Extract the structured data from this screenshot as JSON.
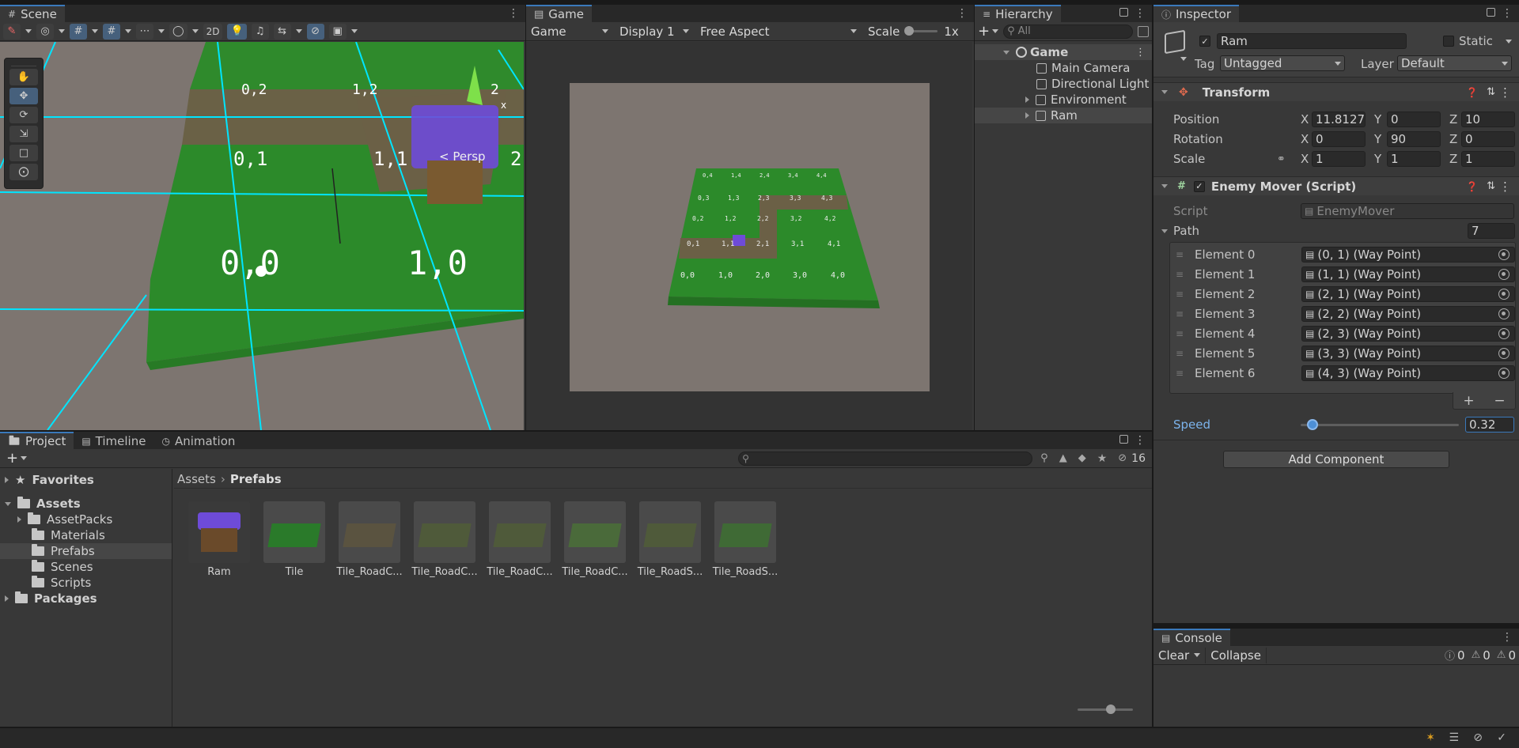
{
  "scene": {
    "tab": "Scene",
    "btn_2d": "2D",
    "labels": [
      "0,2",
      "1,2",
      "2",
      "0,1",
      "1,1",
      "2",
      "0,0",
      "1,0"
    ],
    "persp": "< Persp",
    "axis_x": "x"
  },
  "game": {
    "tab": "Game",
    "mode": "Game",
    "display": "Display 1",
    "aspect": "Free Aspect",
    "scale_label": "Scale",
    "scale_value": "1x",
    "grid_labels": [
      [
        "0,4",
        "1,4",
        "2,4",
        "3,4",
        "4,4"
      ],
      [
        "0,3",
        "1,3",
        "2,3",
        "3,3",
        "4,3"
      ],
      [
        "0,2",
        "1,2",
        "2,2",
        "3,2",
        "4,2"
      ],
      [
        "0,1",
        "1,1",
        "2,1",
        "3,1",
        "4,1"
      ],
      [
        "0,0",
        "1,0",
        "2,0",
        "3,0",
        "4,0"
      ]
    ]
  },
  "hierarchy": {
    "tab": "Hierarchy",
    "search_placeholder": "All",
    "items": [
      "Game",
      "Main Camera",
      "Directional Light",
      "Environment",
      "Ram"
    ]
  },
  "inspector": {
    "tab": "Inspector",
    "name": "Ram",
    "static_label": "Static",
    "tag_label": "Tag",
    "tag_value": "Untagged",
    "layer_label": "Layer",
    "layer_value": "Default",
    "transform": {
      "title": "Transform",
      "position_label": "Position",
      "rotation_label": "Rotation",
      "scale_label": "Scale",
      "position": {
        "x": "11.81275",
        "y": "0",
        "z": "10"
      },
      "rotation": {
        "x": "0",
        "y": "90",
        "z": "0"
      },
      "scale": {
        "x": "1",
        "y": "1",
        "z": "1"
      }
    },
    "enemy_mover": {
      "title": "Enemy Mover (Script)",
      "script_label": "Script",
      "script_value": "EnemyMover",
      "path_label": "Path",
      "path_count": "7",
      "elements": [
        {
          "label": "Element 0",
          "value": "(0, 1) (Way Point)"
        },
        {
          "label": "Element 1",
          "value": "(1, 1) (Way Point)"
        },
        {
          "label": "Element 2",
          "value": "(2, 1) (Way Point)"
        },
        {
          "label": "Element 3",
          "value": "(2, 2) (Way Point)"
        },
        {
          "label": "Element 4",
          "value": "(2, 3) (Way Point)"
        },
        {
          "label": "Element 5",
          "value": "(3, 3) (Way Point)"
        },
        {
          "label": "Element 6",
          "value": "(4, 3) (Way Point)"
        }
      ],
      "speed_label": "Speed",
      "speed_value": "0.32",
      "speed_fraction": 0.05
    },
    "add_component": "Add Component"
  },
  "console": {
    "tab": "Console",
    "clear": "Clear",
    "collapse": "Collapse",
    "logs": "0",
    "warnings": "0",
    "errors": "0"
  },
  "project": {
    "tabs": [
      "Project",
      "Timeline",
      "Animation"
    ],
    "hidden_count": "16",
    "favorites": "Favorites",
    "assets": "Assets",
    "folders": [
      "AssetPacks",
      "Materials",
      "Prefabs",
      "Scenes",
      "Scripts"
    ],
    "packages": "Packages",
    "breadcrumb": [
      "Assets",
      "Prefabs"
    ],
    "prefabs": [
      "Ram",
      "Tile",
      "Tile_RoadC...",
      "Tile_RoadC...",
      "Tile_RoadC...",
      "Tile_RoadC...",
      "Tile_RoadS...",
      "Tile_RoadS..."
    ]
  },
  "colors": {
    "accent": "#3a79bb",
    "grass": "#2e8b2e",
    "road": "#6b6046",
    "gizmo_cyan": "#00e5ff",
    "ram_purple": "#6e4bd8"
  }
}
